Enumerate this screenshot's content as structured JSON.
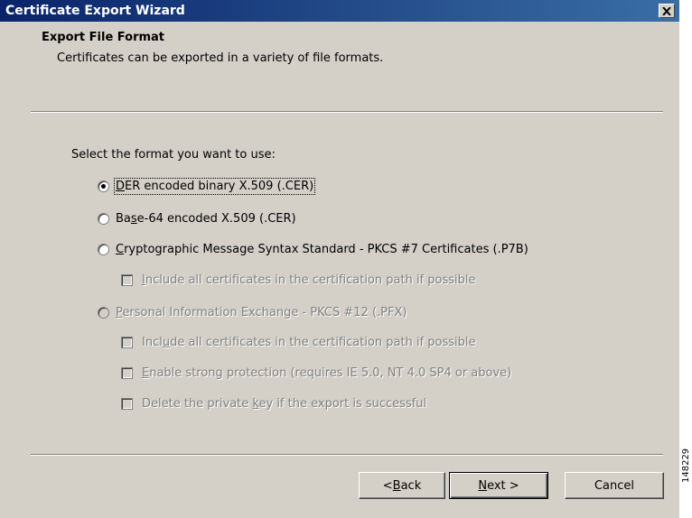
{
  "window": {
    "title": "Certificate Export Wizard"
  },
  "header": {
    "title": "Export File Format",
    "subtitle": "Certificates can be exported in a variety of file formats."
  },
  "prompt": "Select the format you want to use:",
  "options": [
    {
      "pre": "",
      "key": "D",
      "post": "ER encoded binary X.509 (.CER)",
      "selected": true,
      "enabled": true
    },
    {
      "pre": "Ba",
      "key": "s",
      "post": "e-64 encoded X.509 (.CER)",
      "selected": false,
      "enabled": true
    },
    {
      "pre": "",
      "key": "C",
      "post": "ryptographic Message Syntax Standard - PKCS #7 Certificates (.P7B)",
      "selected": false,
      "enabled": true
    },
    {
      "pre": "",
      "key": "P",
      "post": "ersonal Information Exchange - PKCS #12 (.PFX)",
      "selected": false,
      "enabled": false
    }
  ],
  "checkboxes": [
    {
      "pre": "",
      "key": "I",
      "post": "nclude all certificates in the certification path if possible",
      "checked": false,
      "enabled": false
    },
    {
      "pre": "Incl",
      "key": "u",
      "post": "de all certificates in the certification path if possible",
      "checked": false,
      "enabled": false
    },
    {
      "pre": "",
      "key": "E",
      "post": "nable strong protection (requires IE 5.0, NT 4.0 SP4 or above)",
      "checked": false,
      "enabled": false
    },
    {
      "pre": "Delete the private ",
      "key": "k",
      "post": "ey if the export is successful",
      "checked": false,
      "enabled": false
    }
  ],
  "buttons": {
    "back": {
      "pre": "< ",
      "key": "B",
      "post": "ack"
    },
    "next": {
      "pre": "",
      "key": "N",
      "post": "ext >"
    },
    "cancel": "Cancel"
  },
  "side_code": "148229",
  "colors": {
    "face": "#d4d0c8",
    "title_bar": "#0a246a",
    "disabled_text": "#808080"
  },
  "icons": {
    "close": "close-icon"
  }
}
